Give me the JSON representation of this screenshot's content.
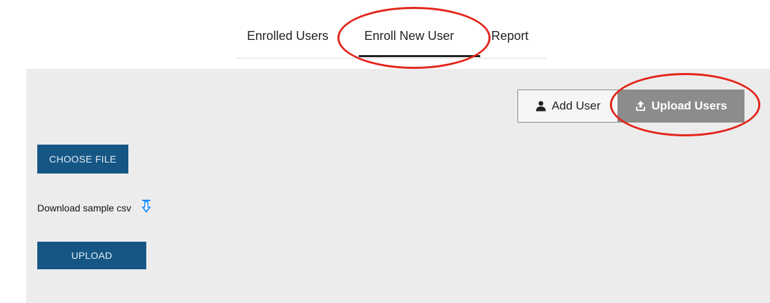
{
  "tabs": {
    "enrolled_users": "Enrolled Users",
    "enroll_new_user": "Enroll New User",
    "report": "Report",
    "active": "Enroll New User"
  },
  "mode_toggle": {
    "add_user": "Add User",
    "add_user_icon": "user-icon",
    "upload_users": "Upload Users",
    "upload_users_icon": "upload-icon",
    "active": "Upload Users"
  },
  "upload_form": {
    "choose_file": "CHOOSE FILE",
    "download_label": "Download sample csv",
    "download_icon": "download-icon",
    "upload": "UPLOAD"
  },
  "colors": {
    "primary_button": "#155685",
    "active_toggle": "#8c8c8c",
    "annotation": "#e3251b",
    "panel_background": "#ececec",
    "download_icon": "#1a8cff"
  }
}
